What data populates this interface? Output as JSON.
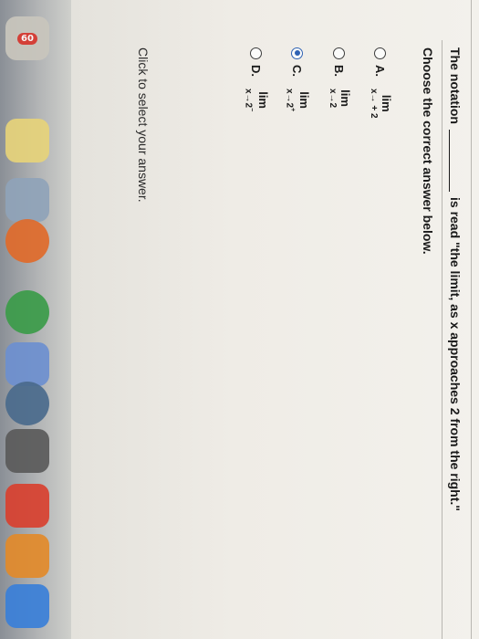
{
  "question": {
    "before_blank": "The notation",
    "after_blank": "is read \"the limit, as x approaches 2 from the right.\""
  },
  "instruction": "Choose the correct answer below.",
  "options": [
    {
      "letter": "A.",
      "lim": "lim",
      "sub": "x→ + 2",
      "sup": "",
      "selected": false
    },
    {
      "letter": "B.",
      "lim": "lim",
      "sub": "x→2",
      "sup": "",
      "selected": false
    },
    {
      "letter": "C.",
      "lim": "lim",
      "sub": "x→2",
      "sup": "+",
      "selected": true
    },
    {
      "letter": "D.",
      "lim": "lim",
      "sub": "x→2",
      "sup": "−",
      "selected": false
    }
  ],
  "footer": "Click to select your answer.",
  "dock": {
    "badge": "60",
    "colors": [
      "#d8372e",
      "#e6b23a",
      "#3a78c9",
      "#e85d2a",
      "#3b8b3f",
      "#6a8fd1",
      "#5a5a5a",
      "#c94a3a",
      "#d8402f",
      "#e28a2a",
      "#3a7fd8"
    ]
  }
}
